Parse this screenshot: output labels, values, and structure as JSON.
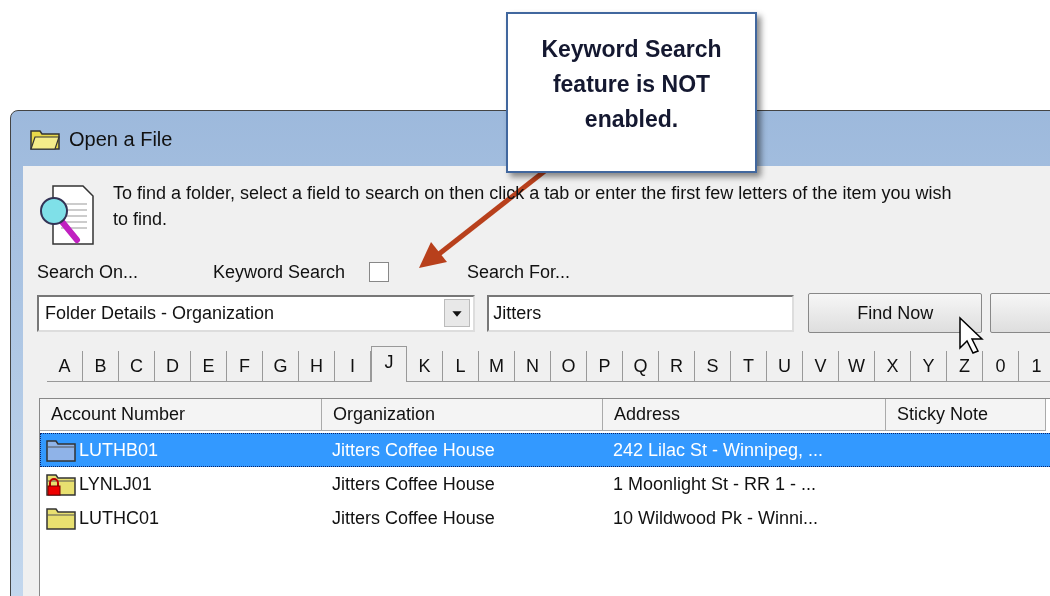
{
  "window": {
    "title": "Open a File"
  },
  "instructions": "To find a folder, select a field to search on then click a tab or enter the first few letters of the item you wish to find.",
  "search_on": {
    "label": "Search On...",
    "value": "Folder Details - Organization"
  },
  "keyword_search": {
    "label": "Keyword Search",
    "checked": false
  },
  "search_for": {
    "label": "Search For...",
    "value": "Jitters"
  },
  "find_button": {
    "label": "Find Now"
  },
  "tabs": [
    {
      "label": "A",
      "selected": false
    },
    {
      "label": "B",
      "selected": false
    },
    {
      "label": "C",
      "selected": false
    },
    {
      "label": "D",
      "selected": false
    },
    {
      "label": "E",
      "selected": false
    },
    {
      "label": "F",
      "selected": false
    },
    {
      "label": "G",
      "selected": false
    },
    {
      "label": "H",
      "selected": false
    },
    {
      "label": "I",
      "selected": false
    },
    {
      "label": "J",
      "selected": true
    },
    {
      "label": "K",
      "selected": false
    },
    {
      "label": "L",
      "selected": false
    },
    {
      "label": "M",
      "selected": false
    },
    {
      "label": "N",
      "selected": false
    },
    {
      "label": "O",
      "selected": false
    },
    {
      "label": "P",
      "selected": false
    },
    {
      "label": "Q",
      "selected": false
    },
    {
      "label": "R",
      "selected": false
    },
    {
      "label": "S",
      "selected": false
    },
    {
      "label": "T",
      "selected": false
    },
    {
      "label": "U",
      "selected": false
    },
    {
      "label": "V",
      "selected": false
    },
    {
      "label": "W",
      "selected": false
    },
    {
      "label": "X",
      "selected": false
    },
    {
      "label": "Y",
      "selected": false
    },
    {
      "label": "Z",
      "selected": false
    },
    {
      "label": "0",
      "selected": false
    },
    {
      "label": "1",
      "selected": false
    }
  ],
  "table": {
    "columns": [
      "Account Number",
      "Organization",
      "Address",
      "Sticky Note"
    ],
    "rows": [
      {
        "kind": "folder",
        "selected": true,
        "cells": [
          "LUTHB01",
          "Jitters Coffee House",
          "242 Lilac St  - Winnipeg, ..."
        ]
      },
      {
        "kind": "locked-folder",
        "selected": false,
        "cells": [
          "LYNLJ01",
          "Jitters Coffee House",
          "1 Moonlight St  - RR 1 - ..."
        ]
      },
      {
        "kind": "folder",
        "selected": false,
        "cells": [
          "LUTHC01",
          "Jitters Coffee House",
          "10 Wildwood Pk  - Winni..."
        ]
      }
    ]
  },
  "callout": {
    "text": "Keyword Search feature is NOT enabled."
  }
}
